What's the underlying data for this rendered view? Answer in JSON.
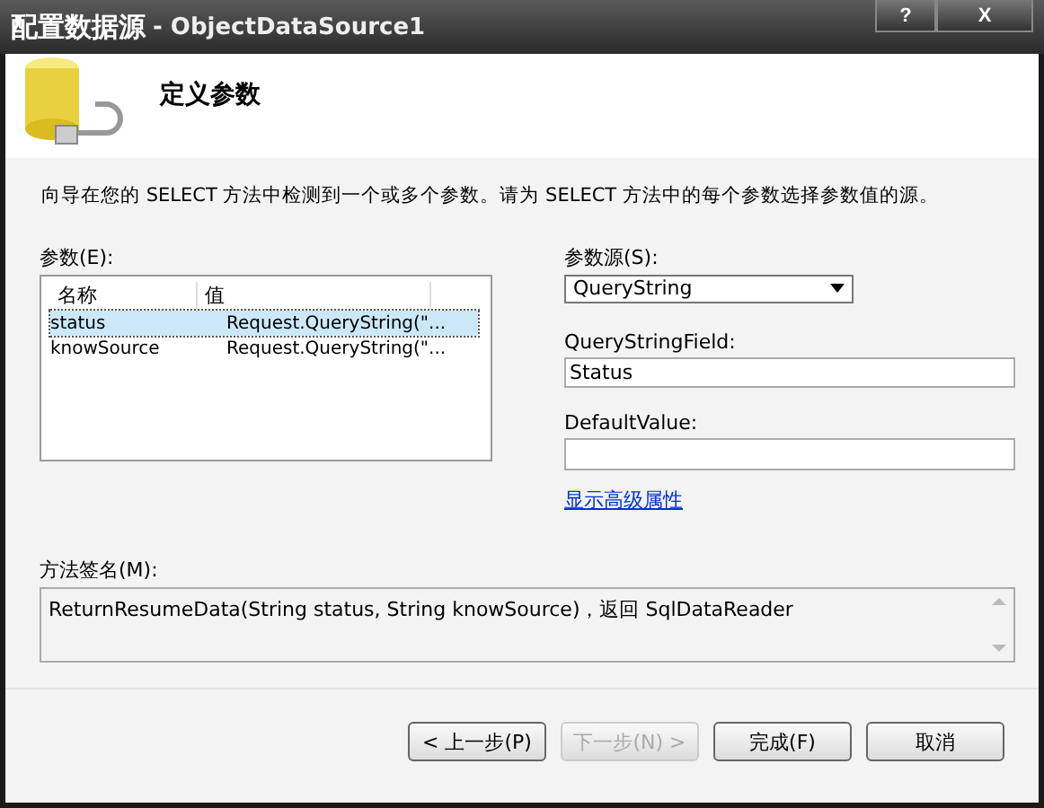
{
  "window": {
    "title": "配置数据源",
    "subtitle": "- ObjectDataSource1",
    "controls": [
      "?",
      "X"
    ]
  },
  "header": {
    "title": "定义参数"
  },
  "description": "向导在您的 SELECT 方法中检测到一个或多个参数。请为 SELECT 方法中的每个参数选择参数值的源。",
  "parameters": {
    "label": "参数(E):",
    "columns": [
      "名称",
      "值"
    ],
    "rows": [
      {
        "name": "status",
        "value": "Request.QueryString(\"...",
        "selected": true
      },
      {
        "name": "knowSource",
        "value": "Request.QueryString(\"...",
        "selected": false
      }
    ]
  },
  "source": {
    "label": "参数源(S):",
    "value": "QueryString"
  },
  "fields": [
    {
      "label": "QueryStringField:",
      "value": "Status"
    },
    {
      "label": "DefaultValue:"
    }
  ],
  "advanced_link": "显示高级属性",
  "signature": {
    "label": "方法签名(M):",
    "value": "ReturnResumeData(String status, String knowSource)，返回 SqlDataReader"
  },
  "buttons": [
    {
      "label": "< 上一步(P)",
      "disabled": false
    },
    {
      "label": "下一步(N) >",
      "disabled": true
    },
    {
      "label": "完成(F)",
      "disabled": false
    },
    {
      "label": "取消",
      "disabled": false
    }
  ]
}
